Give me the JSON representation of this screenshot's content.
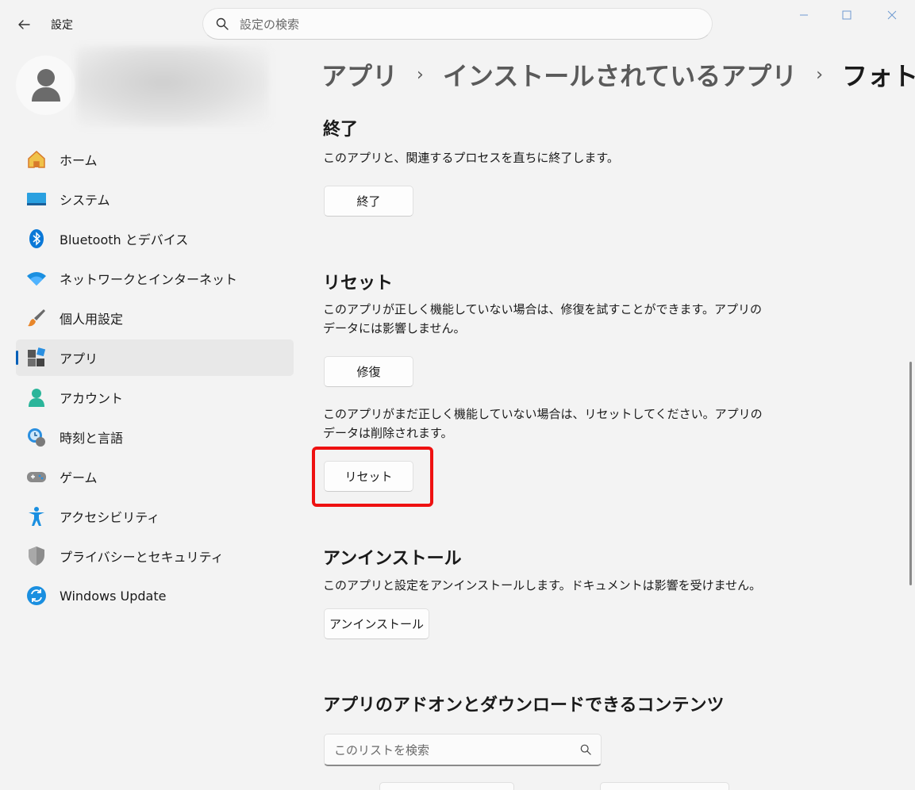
{
  "window": {
    "title": "設定",
    "search_placeholder": "設定の検索"
  },
  "sidebar": {
    "items": [
      {
        "label": "ホーム",
        "icon": "home-icon"
      },
      {
        "label": "システム",
        "icon": "system-icon"
      },
      {
        "label": "Bluetooth とデバイス",
        "icon": "bluetooth-icon"
      },
      {
        "label": "ネットワークとインターネット",
        "icon": "wifi-icon"
      },
      {
        "label": "個人用設定",
        "icon": "brush-icon"
      },
      {
        "label": "アプリ",
        "icon": "apps-icon",
        "active": true
      },
      {
        "label": "アカウント",
        "icon": "account-icon"
      },
      {
        "label": "時刻と言語",
        "icon": "time-language-icon"
      },
      {
        "label": "ゲーム",
        "icon": "gamepad-icon"
      },
      {
        "label": "アクセシビリティ",
        "icon": "accessibility-icon"
      },
      {
        "label": "プライバシーとセキュリティ",
        "icon": "shield-icon"
      },
      {
        "label": "Windows Update",
        "icon": "update-icon"
      }
    ]
  },
  "breadcrumb": [
    "アプリ",
    "インストールされているアプリ",
    "フォト"
  ],
  "terminate": {
    "title": "終了",
    "description": "このアプリと、関連するプロセスを直ちに終了します。",
    "button": "終了"
  },
  "reset": {
    "title": "リセット",
    "repair_description": "このアプリが正しく機能していない場合は、修復を試すことができます。アプリのデータには影響しません。",
    "repair_button": "修復",
    "reset_description": "このアプリがまだ正しく機能していない場合は、リセットしてください。アプリのデータは削除されます。",
    "reset_button": "リセット"
  },
  "uninstall": {
    "title": "アンインストール",
    "description": "このアプリと設定をアンインストールします。ドキュメントは影響を受けません。",
    "button": "アンインストール"
  },
  "addons": {
    "title": "アプリのアドオンとダウンロードできるコンテンツ",
    "search_placeholder": "このリストを検索"
  },
  "colors": {
    "accent": "#005fb8",
    "highlight": "#ee1111"
  }
}
